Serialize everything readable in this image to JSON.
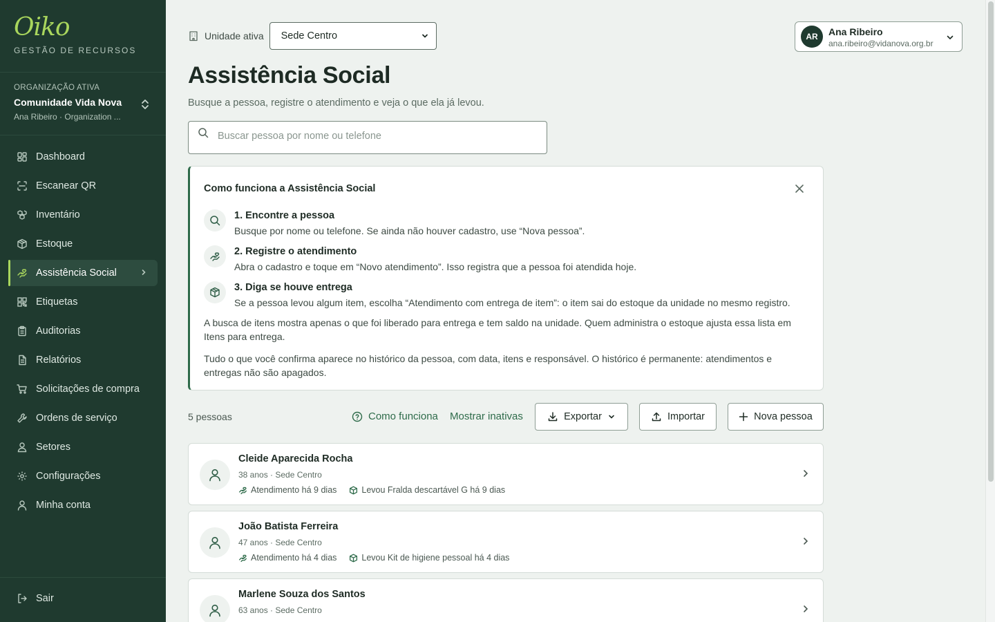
{
  "brand": {
    "logo": "Oiko",
    "tagline": "GESTÃO DE RECURSOS"
  },
  "organization": {
    "label": "ORGANIZAÇÃO ATIVA",
    "name": "Comunidade Vida Nova",
    "sub": "Ana Ribeiro · Organization ..."
  },
  "sidebar": {
    "items": [
      {
        "label": "Dashboard",
        "icon": "dashboard-icon"
      },
      {
        "label": "Escanear QR",
        "icon": "scan-icon"
      },
      {
        "label": "Inventário",
        "icon": "boxes-icon"
      },
      {
        "label": "Estoque",
        "icon": "package-icon"
      },
      {
        "label": "Assistência Social",
        "icon": "hand-heart-icon",
        "active": true
      },
      {
        "label": "Etiquetas",
        "icon": "qr-code-icon"
      },
      {
        "label": "Auditorias",
        "icon": "clipboard-icon"
      },
      {
        "label": "Relatórios",
        "icon": "file-icon"
      },
      {
        "label": "Solicitações de compra",
        "icon": "cart-icon"
      },
      {
        "label": "Ordens de serviço",
        "icon": "wrench-icon"
      },
      {
        "label": "Setores",
        "icon": "user-group-icon"
      },
      {
        "label": "Configurações",
        "icon": "gear-icon"
      },
      {
        "label": "Minha conta",
        "icon": "user-icon"
      }
    ],
    "logout": "Sair"
  },
  "header": {
    "unit_label": "Unidade ativa",
    "unit_value": "Sede Centro",
    "user": {
      "initials": "AR",
      "name": "Ana Ribeiro",
      "email": "ana.ribeiro@vidanova.org.br"
    }
  },
  "page": {
    "title": "Assistência Social",
    "subtitle": "Busque a pessoa, registre o atendimento e veja o que ela já levou.",
    "search_placeholder": "Buscar pessoa por nome ou telefone"
  },
  "info": {
    "title": "Como funciona a Assistência Social",
    "steps": [
      {
        "title": "1. Encontre a pessoa",
        "desc": "Busque por nome ou telefone. Se ainda não houver cadastro, use “Nova pessoa”."
      },
      {
        "title": "2. Registre o atendimento",
        "desc": "Abra o cadastro e toque em “Novo atendimento”. Isso registra que a pessoa foi atendida hoje."
      },
      {
        "title": "3. Diga se houve entrega",
        "desc": "Se a pessoa levou algum item, escolha “Atendimento com entrega de item”: o item sai do estoque da unidade no mesmo registro."
      }
    ],
    "para1": "A busca de itens mostra apenas o que foi liberado para entrega e tem saldo na unidade. Quem administra o estoque ajusta essa lista em Itens para entrega.",
    "para2": "Tudo o que você confirma aparece no histórico da pessoa, com data, itens e responsável. O histórico é permanente: atendimentos e entregas não são apagados."
  },
  "toolbar": {
    "count": "5 pessoas",
    "how_it_works": "Como funciona",
    "show_inactive": "Mostrar inativas",
    "export": "Exportar",
    "import": "Importar",
    "new_person": "Nova pessoa"
  },
  "people": [
    {
      "name": "Cleide Aparecida Rocha",
      "meta": "38 anos · Sede Centro",
      "attendance": "Atendimento há 9 dias",
      "delivery": "Levou Fralda descartável G há 9 dias"
    },
    {
      "name": "João Batista Ferreira",
      "meta": "47 anos · Sede Centro",
      "attendance": "Atendimento há 4 dias",
      "delivery": "Levou Kit de higiene pessoal há 4 dias"
    },
    {
      "name": "Marlene Souza dos Santos",
      "meta": "63 anos · Sede Centro",
      "attendance": "",
      "delivery": ""
    }
  ]
}
